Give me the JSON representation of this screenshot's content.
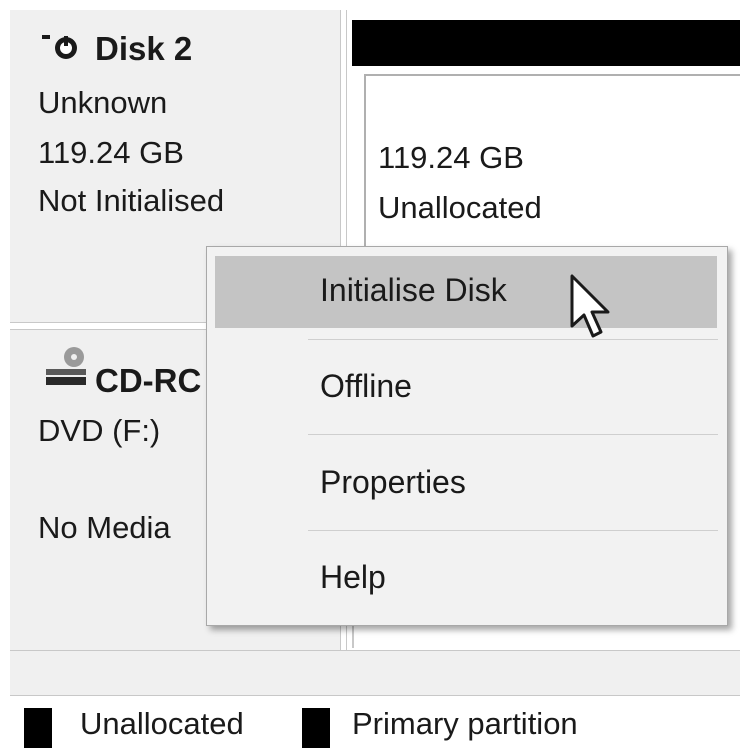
{
  "disk": {
    "title": "Disk 2",
    "type": "Unknown",
    "size": "119.24 GB",
    "status": "Not Initialised",
    "icon": "disk-warning-icon"
  },
  "partition": {
    "size": "119.24 GB",
    "status": "Unallocated"
  },
  "cdrom": {
    "title": "CD-RC",
    "drive": "DVD (F:)",
    "media": "No Media",
    "icon": "cd-drive-icon"
  },
  "context_menu": {
    "items": [
      {
        "label": "Initialise Disk",
        "highlighted": true
      },
      {
        "label": "Offline"
      },
      {
        "label": "Properties"
      },
      {
        "label": "Help"
      }
    ]
  },
  "legend": {
    "items": [
      {
        "label": "Unallocated",
        "color": "#000000"
      },
      {
        "label": "Primary partition",
        "color": "#000000"
      }
    ]
  },
  "colors": {
    "menu_highlight": "#c4c4c4",
    "panel_bg": "#f0f0f0"
  }
}
